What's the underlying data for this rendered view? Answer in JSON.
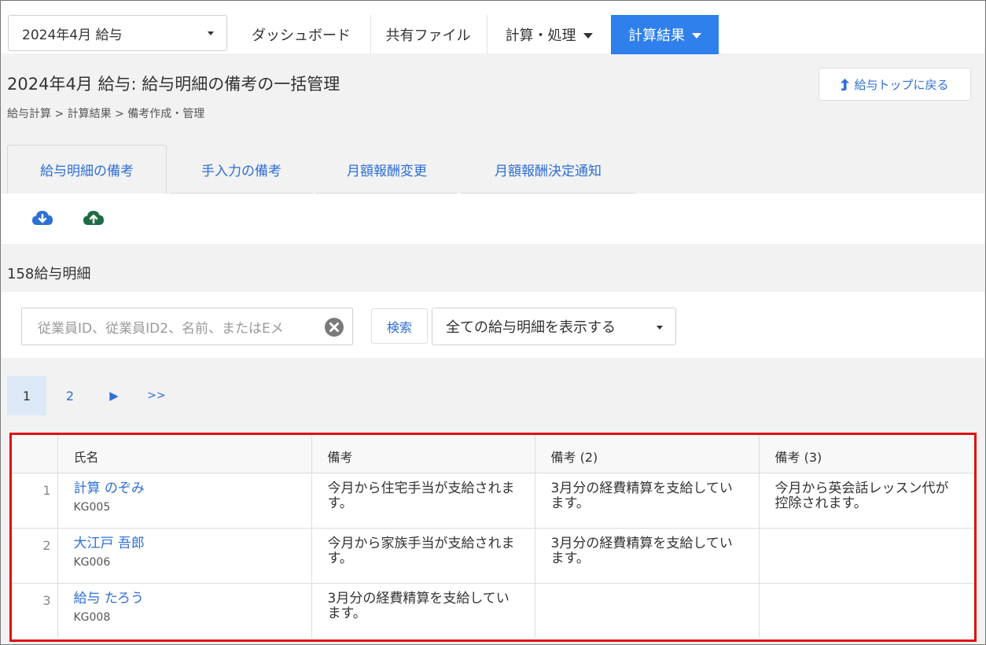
{
  "nav": {
    "period_value": "2024年4月 給与",
    "items": [
      {
        "label": "ダッシュボード",
        "has_menu": false
      },
      {
        "label": "共有ファイル",
        "has_menu": false
      },
      {
        "label": "計算・処理",
        "has_menu": true
      },
      {
        "label": "計算結果",
        "has_menu": true,
        "active": true
      }
    ]
  },
  "header": {
    "title": "2024年4月 給与: 給与明細の備考の一括管理",
    "breadcrumb": "給与計算 > 計算結果 > 備考作成・管理",
    "back_button_label": "給与トップに戻る"
  },
  "tabs": [
    {
      "label": "給与明細の備考",
      "active": true
    },
    {
      "label": "手入力の備考"
    },
    {
      "label": "月額報酬変更"
    },
    {
      "label": "月額報酬決定通知"
    }
  ],
  "toolbar": {
    "download_icon": "cloud-download-icon",
    "upload_icon": "cloud-upload-icon"
  },
  "count_label": "158給与明細",
  "filter": {
    "search_placeholder": "従業員ID、従業員ID2、名前、またはEメ",
    "search_button_label": "検索",
    "select_value": "全ての給与明細を表示する"
  },
  "pagination": {
    "current": "1",
    "pages": [
      "1",
      "2"
    ],
    "next": "▶",
    "last": ">>"
  },
  "table": {
    "columns": [
      "",
      "氏名",
      "備考",
      "備考 (2)",
      "備考 (3)"
    ],
    "rows": [
      {
        "num": "1",
        "name": "計算 のぞみ",
        "id": "KG005",
        "note1": "今月から住宅手当が支給されます。",
        "note2": "3月分の経費精算を支給しています。",
        "note3": "今月から英会話レッスン代が控除されます。"
      },
      {
        "num": "2",
        "name": "大江戸 吾郎",
        "id": "KG006",
        "note1": "今月から家族手当が支給されます。",
        "note2": "3月分の経費精算を支給しています。",
        "note3": ""
      },
      {
        "num": "3",
        "name": "給与 たろう",
        "id": "KG008",
        "note1": "3月分の経費精算を支給しています。",
        "note2": "",
        "note3": ""
      }
    ]
  },
  "colors": {
    "accent": "#2f80ed",
    "link": "#2f6fd6",
    "highlight_border": "#e01010",
    "download_icon": "#2f6fd6",
    "upload_icon": "#1e6b45"
  }
}
